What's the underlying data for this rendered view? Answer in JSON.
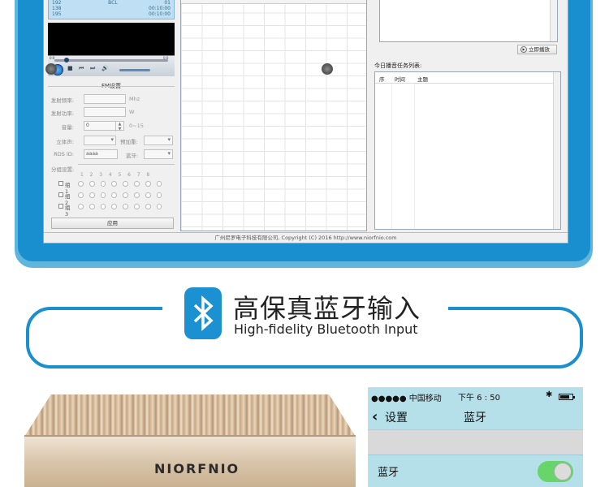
{
  "software": {
    "status_lines": [
      [
        "192",
        "",
        "BCL",
        "01"
      ],
      [
        "138",
        "",
        "",
        "00:10:00"
      ],
      [
        "195",
        "",
        "",
        "00:10:00"
      ]
    ],
    "player": {
      "time_left": "0:0",
      "time_right": "0:0"
    },
    "fm_group": {
      "title": "FM设置",
      "freq_label": "发射频率:",
      "freq_unit": "Mhz",
      "power_label": "发射功率:",
      "power_unit": "W",
      "volume_label": "音量:",
      "volume_value": "0",
      "volume_range": "0~15",
      "stereo_label": "立体声:",
      "preemph_label": "预加重:",
      "rds_label": "RDS ID:",
      "rds_value": "aaaa",
      "bt_label": "蓝牙:"
    },
    "group_settings": {
      "label": "分组设置:",
      "columns": [
        "1",
        "2",
        "3",
        "4",
        "5",
        "6",
        "7",
        "8"
      ],
      "rows": [
        "组1",
        "组2",
        "组3"
      ]
    },
    "apply_label": "应用",
    "play_now_label": "立即播放",
    "task_list": {
      "title": "今日播音任务列表:",
      "col_index": "序",
      "col_time": "时间",
      "col_topic": "主题"
    },
    "footer": "广州尼罗电子科技有限公司, Copyright (C) 2016  http://www.niorfnio.com"
  },
  "banner": {
    "title_cn": "高保真蓝牙输入",
    "title_en": "High-fidelity Bluetooth Input"
  },
  "device": {
    "brand": "NIORFNIO"
  },
  "phone": {
    "carrier": "●●●●● 中国移动",
    "time": "下午 6 : 50",
    "bt_glyph": "✱",
    "back_glyph": "‹",
    "back_label": "设置",
    "nav_title": "蓝牙",
    "row_label": "蓝牙",
    "bluetooth_on": true
  },
  "colors": {
    "frame_blue": "#1a8fcf",
    "bt_tile": "#1b91d2",
    "toggle_on": "#67d56a"
  }
}
